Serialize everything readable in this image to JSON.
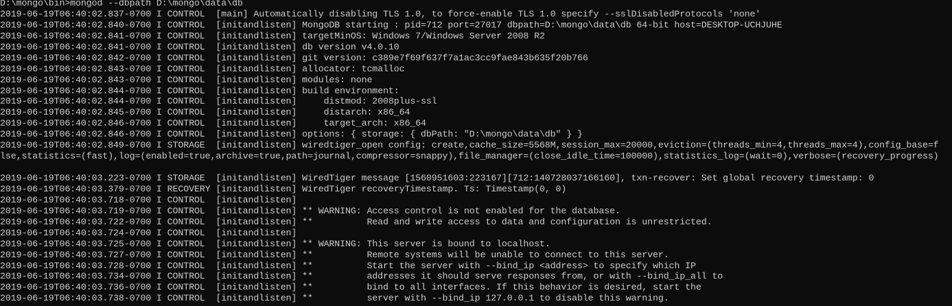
{
  "terminal": {
    "lines": [
      "D:\\mongo\\bin>mongod --dbpath D:\\mongo\\data\\db",
      "2019-06-19T06:40:02.837-0700 I CONTROL  [main] Automatically disabling TLS 1.0, to force-enable TLS 1.0 specify --sslDisabledProtocols 'none'",
      "2019-06-19T06:40:02.840-0700 I CONTROL  [initandlisten] MongoDB starting : pid=712 port=27017 dbpath=D:\\mongo\\data\\db 64-bit host=DESKTOP-UCHJUHE",
      "2019-06-19T06:40:02.841-0700 I CONTROL  [initandlisten] targetMinOS: Windows 7/Windows Server 2008 R2",
      "2019-06-19T06:40:02.841-0700 I CONTROL  [initandlisten] db version v4.0.10",
      "2019-06-19T06:40:02.842-0700 I CONTROL  [initandlisten] git version: c389e7f69f637f7a1ac3cc9fae843b635f20b766",
      "2019-06-19T06:40:02.843-0700 I CONTROL  [initandlisten] allocator: tcmalloc",
      "2019-06-19T06:40:02.843-0700 I CONTROL  [initandlisten] modules: none",
      "2019-06-19T06:40:02.844-0700 I CONTROL  [initandlisten] build environment:",
      "2019-06-19T06:40:02.844-0700 I CONTROL  [initandlisten]     distmod: 2008plus-ssl",
      "2019-06-19T06:40:02.845-0700 I CONTROL  [initandlisten]     distarch: x86_64",
      "2019-06-19T06:40:02.846-0700 I CONTROL  [initandlisten]     target_arch: x86_64",
      "2019-06-19T06:40:02.846-0700 I CONTROL  [initandlisten] options: { storage: { dbPath: \"D:\\mongo\\data\\db\" } }",
      "2019-06-19T06:40:02.849-0700 I STORAGE  [initandlisten] wiredtiger_open config: create,cache_size=5568M,session_max=20000,eviction=(threads_min=4,threads_max=4),config_base=f",
      "lse,statistics=(fast),log=(enabled=true,archive=true,path=journal,compressor=snappy),file_manager=(close_idle_time=100000),statistics_log=(wait=0),verbose=(recovery_progress)",
      "",
      "2019-06-19T06:40:03.223-0700 I STORAGE  [initandlisten] WiredTiger message [1560951603:223167][712:140728037166160], txn-recover: Set global recovery timestamp: 0",
      "2019-06-19T06:40:03.379-0700 I RECOVERY [initandlisten] WiredTiger recoveryTimestamp. Ts: Timestamp(0, 0)",
      "2019-06-19T06:40:03.718-0700 I CONTROL  [initandlisten]",
      "2019-06-19T06:40:03.719-0700 I CONTROL  [initandlisten] ** WARNING: Access control is not enabled for the database.",
      "2019-06-19T06:40:03.722-0700 I CONTROL  [initandlisten] **          Read and write access to data and configuration is unrestricted.",
      "2019-06-19T06:40:03.724-0700 I CONTROL  [initandlisten]",
      "2019-06-19T06:40:03.725-0700 I CONTROL  [initandlisten] ** WARNING: This server is bound to localhost.",
      "2019-06-19T06:40:03.727-0700 I CONTROL  [initandlisten] **          Remote systems will be unable to connect to this server.",
      "2019-06-19T06:40:03.728-0700 I CONTROL  [initandlisten] **          Start the server with --bind_ip <address> to specify which IP",
      "2019-06-19T06:40:03.734-0700 I CONTROL  [initandlisten] **          addresses it should serve responses from, or with --bind_ip_all to",
      "2019-06-19T06:40:03.736-0700 I CONTROL  [initandlisten] **          bind to all interfaces. If this behavior is desired, start the",
      "2019-06-19T06:40:03.738-0700 I CONTROL  [initandlisten] **          server with --bind_ip 127.0.0.1 to disable this warning."
    ],
    "colors": {
      "background": "#0c0c0c",
      "text": "#cccccc"
    }
  }
}
